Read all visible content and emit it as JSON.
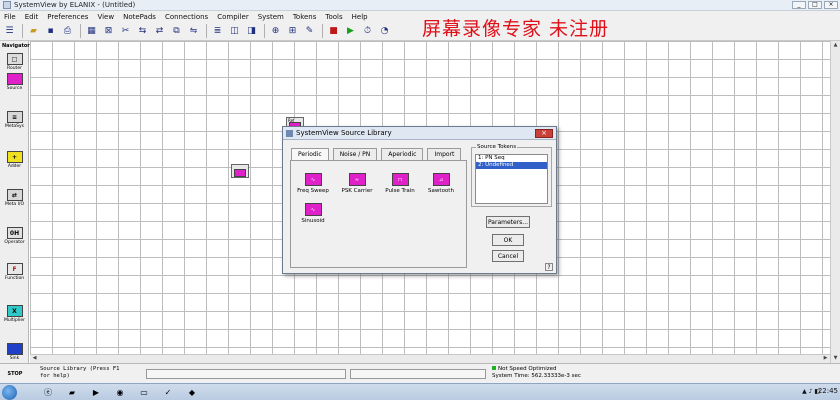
{
  "window": {
    "title": "SystemView by ELANIX - (Untitled)",
    "min": "_",
    "max": "□",
    "close": "×"
  },
  "watermark": "屏幕录像专家 未注册",
  "menu": [
    "File",
    "Edit",
    "Preferences",
    "View",
    "NotePads",
    "Connections",
    "Compiler",
    "System",
    "Tokens",
    "Tools",
    "Help"
  ],
  "navigator": {
    "title": "Navigator",
    "items": [
      {
        "label": "Router",
        "glyph": "□"
      },
      {
        "label": "Source",
        "glyph": ""
      },
      {
        "label": "MetaSys",
        "glyph": "≡"
      },
      {
        "label": "Adder",
        "glyph": "+"
      },
      {
        "label": "Meta I/O",
        "glyph": "⇄"
      },
      {
        "label": "Operator",
        "glyph": "0H"
      },
      {
        "label": "Function",
        "glyph": "F"
      },
      {
        "label": "Multiplier",
        "glyph": "X"
      },
      {
        "label": "Sink",
        "glyph": ""
      }
    ]
  },
  "canvas_tokens": [
    {
      "label": ""
    },
    {
      "label": "Ref"
    }
  ],
  "dialog": {
    "title": "SystemView Source Library",
    "close": "×",
    "tabs": [
      "Periodic",
      "Noise / PN",
      "Aperiodic",
      "Import"
    ],
    "sources": [
      {
        "label": "Freq Sweep",
        "glyph": "∿"
      },
      {
        "label": "PSK Carrier",
        "glyph": "≈"
      },
      {
        "label": "Pulse Train",
        "glyph": "⊓"
      },
      {
        "label": "Sawtooth",
        "glyph": "⊿"
      },
      {
        "label": "Sinusoid",
        "glyph": "∿"
      }
    ],
    "tokens_group_label": "Source Tokens",
    "tokens": [
      "1: PN Seq",
      "2: Undefined"
    ],
    "parameters_button": "Parameters...",
    "ok_button": "OK",
    "cancel_button": "Cancel",
    "help": "?"
  },
  "status": {
    "left_line1": "Source Library (Press F1",
    "left_line2": "for help)",
    "right_line1": "Not Speed Optimized",
    "right_line2": "System Time: 562.33333e-3 sec",
    "stop_label": "STOP"
  },
  "taskbar": {
    "clock": "22:45"
  },
  "colors": {
    "token_magenta": "#e020c8",
    "watermark_red": "#e0101a",
    "selection_blue": "#3060c8"
  }
}
